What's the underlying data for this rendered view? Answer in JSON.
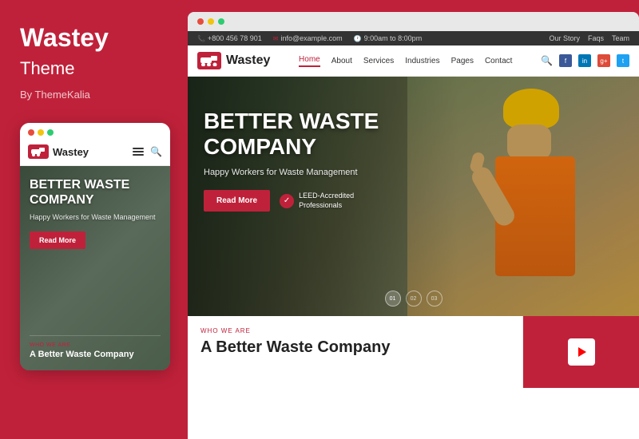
{
  "left": {
    "title": "Wastey",
    "subtitle": "Theme",
    "by": "By ThemeKalia",
    "dots": [
      "red",
      "yellow",
      "green"
    ],
    "mobile_logo": "Wastey",
    "mobile_hero_title": "BETTER WASTE COMPANY",
    "mobile_hero_sub": "Happy Workers for Waste Management",
    "mobile_read_more": "Read More",
    "mobile_who_we_are": "WHO WE ARE",
    "mobile_section_title": "A Better Waste Company"
  },
  "right": {
    "browser_dots": [
      "red",
      "yellow",
      "green"
    ],
    "topbar": {
      "phone": "+800 456 78 901",
      "email": "info@example.com",
      "hours": "9:00am to 8:00pm",
      "links": [
        "Our Story",
        "Faqs",
        "Team"
      ]
    },
    "nav": {
      "logo": "Wastey",
      "links": [
        "Home",
        "About",
        "Services",
        "Industries",
        "Pages",
        "Contact"
      ],
      "active": "Home"
    },
    "hero": {
      "title_line1": "BETTER WASTE",
      "title_line2": "COMPANY",
      "subtitle": "Happy Workers for Waste Management",
      "read_more": "Read More",
      "leed_line1": "LEED-Accredited",
      "leed_line2": "Professionals",
      "dots": [
        "01",
        "02",
        "03"
      ]
    },
    "bottom": {
      "who_we_are": "WHO WE ARE",
      "title": "A Better Waste Company"
    }
  }
}
